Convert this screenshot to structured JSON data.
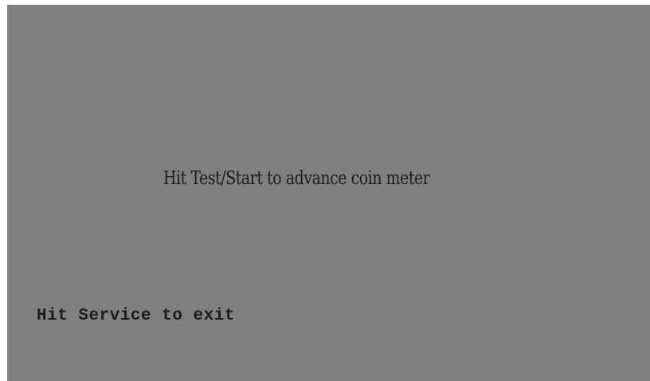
{
  "screen": {
    "background_color": "#808080",
    "text_color": "#1c1c1c",
    "instruction_text": "Hit Test/Start to advance coin meter",
    "exit_text": "Hit Service to exit"
  }
}
